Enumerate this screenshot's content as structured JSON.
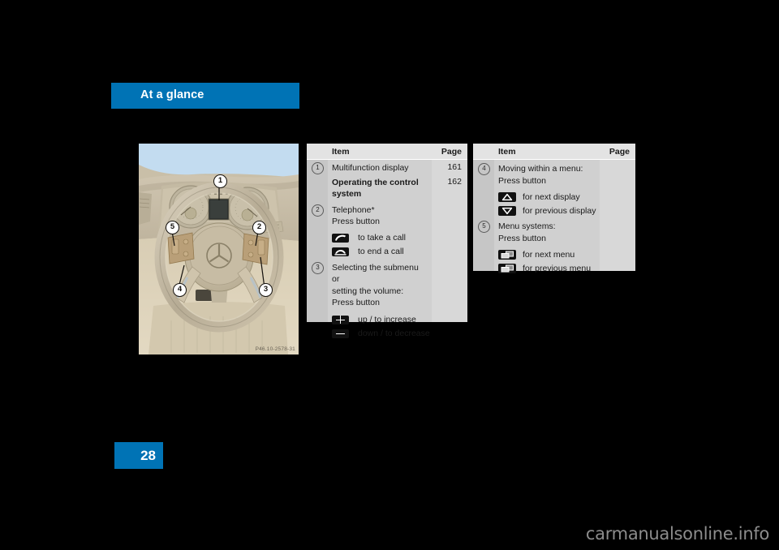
{
  "header": {
    "title": "At a glance",
    "accent_color": "#0073b5"
  },
  "page": {
    "number": "28"
  },
  "figure": {
    "code": "P46.10-2578-31",
    "alt_name": "steering-wheel-photo",
    "callouts": [
      "1",
      "2",
      "3",
      "4",
      "5"
    ]
  },
  "tables": [
    {
      "name": "table-left",
      "headers": {
        "item": "Item",
        "page": "Page"
      },
      "rows": [
        {
          "marker": "1",
          "lines": [
            {
              "text": "Multifunction display",
              "bold": false
            }
          ],
          "page": "161"
        },
        {
          "marker": "",
          "lines": [
            {
              "text": "Operating the control",
              "bold": true
            },
            {
              "text": "system",
              "bold": true
            }
          ],
          "page": "162"
        },
        {
          "marker": "2",
          "lines": [
            {
              "text": "Telephone*",
              "bold": false
            },
            {
              "text": "Press button",
              "bold": false
            }
          ],
          "page": "",
          "icons": [
            {
              "icon": "phone-take-call-icon",
              "label": "to take a call"
            },
            {
              "icon": "phone-end-call-icon",
              "label": "to end a call"
            }
          ]
        },
        {
          "marker": "3",
          "lines": [
            {
              "text": "Selecting the submenu or",
              "bold": false
            },
            {
              "text": "setting the volume:",
              "bold": false
            },
            {
              "text": "Press button",
              "bold": false
            }
          ],
          "page": "",
          "icons": [
            {
              "icon": "plus-button-icon",
              "label": "up / to increase"
            },
            {
              "icon": "minus-button-icon",
              "label": "down / to decrease"
            }
          ]
        }
      ]
    },
    {
      "name": "table-right",
      "headers": {
        "item": "Item",
        "page": "Page"
      },
      "rows": [
        {
          "marker": "4",
          "lines": [
            {
              "text": "Moving within a menu:",
              "bold": false
            },
            {
              "text": "Press button",
              "bold": false
            }
          ],
          "page": "",
          "icons": [
            {
              "icon": "arrow-up-button-icon",
              "label": "for next display"
            },
            {
              "icon": "arrow-down-button-icon",
              "label": "for previous display"
            }
          ]
        },
        {
          "marker": "5",
          "lines": [
            {
              "text": "Menu systems:",
              "bold": false
            },
            {
              "text": "Press button",
              "bold": false
            }
          ],
          "page": "",
          "icons": [
            {
              "icon": "next-menu-button-icon",
              "label": "for next menu"
            },
            {
              "icon": "previous-menu-button-icon",
              "label": "for previous menu"
            }
          ]
        }
      ]
    }
  ],
  "watermark": {
    "text": "carmanualsonline.info"
  }
}
